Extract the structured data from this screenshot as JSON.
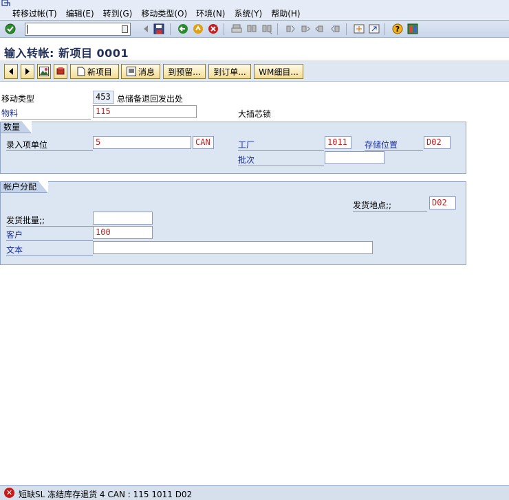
{
  "menu": {
    "items": [
      "转移过帐(T)",
      "编辑(E)",
      "转到(G)",
      "移动类型(O)",
      "环境(N)",
      "系统(Y)",
      "帮助(H)"
    ]
  },
  "std_toolbar": {
    "command_value": ""
  },
  "title": "输入转帐: 新项目 0001",
  "app_toolbar": {
    "new_item": "新项目",
    "message": "消息",
    "to_reservation": "到预留...",
    "to_order": "到订单...",
    "wm_details": "WM细目..."
  },
  "form": {
    "movement_type_label": "移动类型",
    "movement_type_value": "453",
    "movement_type_text": "总储备退回发出处",
    "material_label": "物料",
    "material_value": "115",
    "material_desc": "大插芯锁",
    "quantity_group": {
      "title": "数量",
      "unit_label": "录入项单位",
      "qty_value": "5",
      "unit_value": "CAN",
      "plant_label": "工厂",
      "plant_value": "1011",
      "storage_label": "存储位置",
      "storage_value": "D02",
      "batch_label": "批次",
      "batch_value": ""
    },
    "account_group": {
      "title": "帐户分配",
      "issue_location_label": "发货地点;;",
      "issue_location_value": "D02",
      "issue_batch_label": "发货批量;;",
      "issue_batch_value": "",
      "customer_label": "客户",
      "customer_value": "100",
      "text_label": "文本",
      "text_value": ""
    }
  },
  "status": {
    "type": "error",
    "message": "短缺SL 冻结库存退货 4 CAN : 115 1011 D02"
  }
}
